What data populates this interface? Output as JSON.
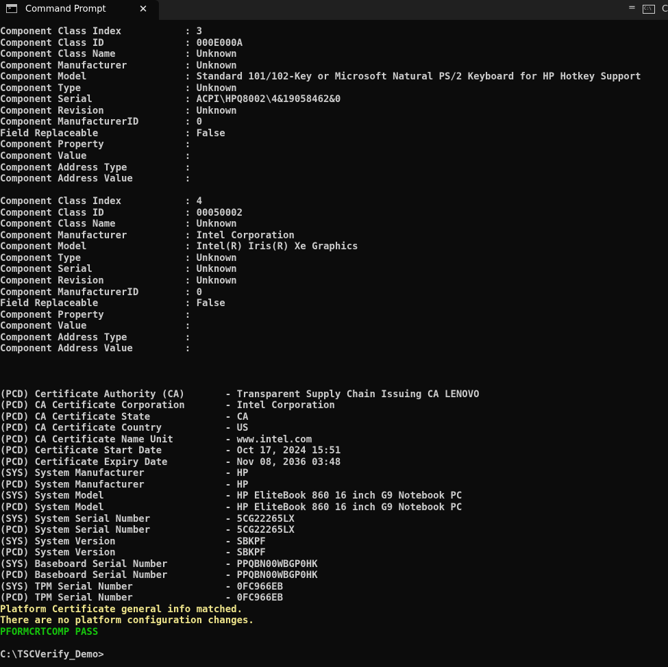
{
  "titlebar": {
    "tab_title": "Command Prompt",
    "close_glyph": "✕",
    "right_glyph": "=",
    "right_letter": "C"
  },
  "console": {
    "lines": [
      {
        "text": "Component Class Index           : 3",
        "color": "default"
      },
      {
        "text": "Component Class ID              : 000E000A",
        "color": "default"
      },
      {
        "text": "Component Class Name            : Unknown",
        "color": "default"
      },
      {
        "text": "Component Manufacturer          : Unknown",
        "color": "default"
      },
      {
        "text": "Component Model                 : Standard 101/102-Key or Microsoft Natural PS/2 Keyboard for HP Hotkey Support",
        "color": "default"
      },
      {
        "text": "Component Type                  : Unknown",
        "color": "default"
      },
      {
        "text": "Component Serial                : ACPI\\HPQ8002\\4&19058462&0",
        "color": "default"
      },
      {
        "text": "Component Revision              : Unknown",
        "color": "default"
      },
      {
        "text": "Component ManufacturerID        : 0",
        "color": "default"
      },
      {
        "text": "Field Replaceable               : False",
        "color": "default"
      },
      {
        "text": "Component Property              :",
        "color": "default"
      },
      {
        "text": "Component Value                 :",
        "color": "default"
      },
      {
        "text": "Component Address Type          :",
        "color": "default"
      },
      {
        "text": "Component Address Value         :",
        "color": "default"
      },
      {
        "text": "",
        "color": "default"
      },
      {
        "text": "Component Class Index           : 4",
        "color": "default"
      },
      {
        "text": "Component Class ID              : 00050002",
        "color": "default"
      },
      {
        "text": "Component Class Name            : Unknown",
        "color": "default"
      },
      {
        "text": "Component Manufacturer          : Intel Corporation",
        "color": "default"
      },
      {
        "text": "Component Model                 : Intel(R) Iris(R) Xe Graphics",
        "color": "default"
      },
      {
        "text": "Component Type                  : Unknown",
        "color": "default"
      },
      {
        "text": "Component Serial                : Unknown",
        "color": "default"
      },
      {
        "text": "Component Revision              : Unknown",
        "color": "default"
      },
      {
        "text": "Component ManufacturerID        : 0",
        "color": "default"
      },
      {
        "text": "Field Replaceable               : False",
        "color": "default"
      },
      {
        "text": "Component Property              :",
        "color": "default"
      },
      {
        "text": "Component Value                 :",
        "color": "default"
      },
      {
        "text": "Component Address Type          :",
        "color": "default"
      },
      {
        "text": "Component Address Value         :",
        "color": "default"
      },
      {
        "text": "",
        "color": "default"
      },
      {
        "text": "",
        "color": "default"
      },
      {
        "text": "",
        "color": "default"
      },
      {
        "text": "(PCD) Certificate Authority (CA)       - Transparent Supply Chain Issuing CA LENOVO",
        "color": "default"
      },
      {
        "text": "(PCD) CA Certificate Corporation       - Intel Corporation",
        "color": "default"
      },
      {
        "text": "(PCD) CA Certificate State             - CA",
        "color": "default"
      },
      {
        "text": "(PCD) CA Certificate Country           - US",
        "color": "default"
      },
      {
        "text": "(PCD) CA Certificate Name Unit         - www.intel.com",
        "color": "default"
      },
      {
        "text": "(PCD) Certificate Start Date           - Oct 17, 2024 15:51",
        "color": "default"
      },
      {
        "text": "(PCD) Certificate Expiry Date          - Nov 08, 2036 03:48",
        "color": "default"
      },
      {
        "text": "(SYS) System Manufacturer              - HP",
        "color": "default"
      },
      {
        "text": "(PCD) System Manufacturer              - HP",
        "color": "default"
      },
      {
        "text": "(SYS) System Model                     - HP EliteBook 860 16 inch G9 Notebook PC",
        "color": "default"
      },
      {
        "text": "(PCD) System Model                     - HP EliteBook 860 16 inch G9 Notebook PC",
        "color": "default"
      },
      {
        "text": "(SYS) System Serial Number             - 5CG22265LX",
        "color": "default"
      },
      {
        "text": "(PCD) System Serial Number             - 5CG22265LX",
        "color": "default"
      },
      {
        "text": "(SYS) System Version                   - SBKPF",
        "color": "default"
      },
      {
        "text": "(PCD) System Version                   - SBKPF",
        "color": "default"
      },
      {
        "text": "(SYS) Baseboard Serial Number          - PPQBN00WBGP0HK",
        "color": "default"
      },
      {
        "text": "(PCD) Baseboard Serial Number          - PPQBN00WBGP0HK",
        "color": "default"
      },
      {
        "text": "(SYS) TPM Serial Number                - 0FC966EB",
        "color": "default"
      },
      {
        "text": "(PCD) TPM Serial Number                - 0FC966EB",
        "color": "default"
      },
      {
        "text": "Platform Certificate general info matched.",
        "color": "yellow"
      },
      {
        "text": "There are no platform configuration changes.",
        "color": "yellow"
      },
      {
        "text": "PFORMCRTCOMP PASS",
        "color": "green"
      },
      {
        "text": "",
        "color": "default"
      },
      {
        "text": "C:\\TSCVerify_Demo>",
        "color": "default"
      }
    ]
  },
  "colors": {
    "background": "#0c0c0c",
    "text": "#cccccc",
    "yellow": "#f0e68c",
    "green": "#16c60c",
    "titlebar": "#202020"
  }
}
